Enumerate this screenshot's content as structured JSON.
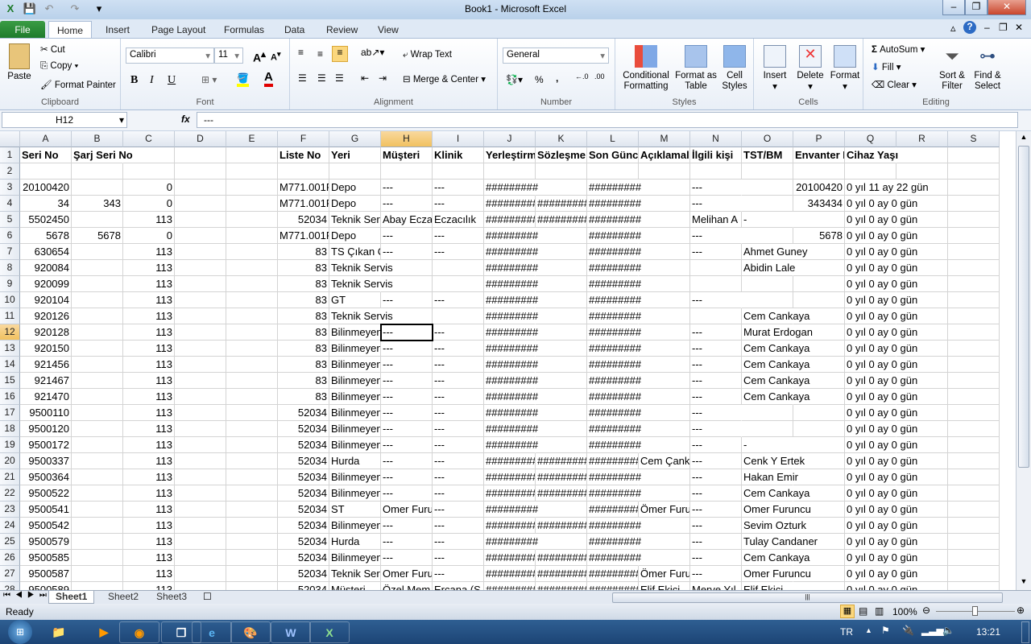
{
  "window": {
    "title": "Book1  -  Microsoft Excel",
    "minimize": "–",
    "restore": "❐",
    "close": "✕"
  },
  "quick_access": {
    "save": "💾",
    "undo": "↶",
    "redo": "↷",
    "customize": "▾"
  },
  "tabs": [
    "File",
    "Home",
    "Insert",
    "Page Layout",
    "Formulas",
    "Data",
    "Review",
    "View"
  ],
  "ribbon": {
    "clipboard": {
      "label": "Clipboard",
      "paste": "Paste",
      "cut": "Cut",
      "copy": "Copy",
      "format_painter": "Format Painter"
    },
    "font": {
      "label": "Font",
      "name": "Calibri",
      "size": "11",
      "bold": "B",
      "italic": "I",
      "underline": "U"
    },
    "alignment": {
      "label": "Alignment",
      "wrap_text": "Wrap Text",
      "merge_center": "Merge & Center"
    },
    "number": {
      "label": "Number",
      "format": "General",
      "percent": "%",
      "comma": ","
    },
    "styles": {
      "label": "Styles",
      "conditional": "Conditional Formatting",
      "format_table": "Format as Table",
      "cell_styles": "Cell Styles"
    },
    "cells": {
      "label": "Cells",
      "insert": "Insert",
      "delete": "Delete",
      "format": "Format"
    },
    "editing": {
      "label": "Editing",
      "autosum": "AutoSum",
      "fill": "Fill",
      "clear": "Clear",
      "sort_filter": "Sort & Filter",
      "find_select": "Find & Select"
    }
  },
  "formula_bar": {
    "name_box": "H12",
    "fx": "fx",
    "value": "---"
  },
  "columns": [
    "A",
    "B",
    "C",
    "D",
    "E",
    "F",
    "G",
    "H",
    "I",
    "J",
    "K",
    "L",
    "M",
    "N",
    "O",
    "P",
    "Q",
    "R",
    "S"
  ],
  "selected": {
    "col": "H",
    "row": 12
  },
  "rows": [
    [
      "Seri No",
      "Şarj Seri No",
      "",
      "",
      "",
      "Liste No",
      "Yeri",
      "Müşteri",
      "Klinik",
      "Yerleştirm",
      "Sözleşme",
      "Son Günce",
      "Açıklamal",
      "İlgili kişi",
      "TST/BM",
      "Envanter N",
      "Cihaz Yaşı"
    ],
    [],
    [
      "20100420",
      "",
      "0",
      "",
      "",
      "M771.001F",
      "Depo",
      "---",
      "---",
      "#########",
      "",
      "#########",
      "",
      "---",
      "",
      "20100420",
      "0 yıl 11 ay 22 gün"
    ],
    [
      "34",
      "343",
      "0",
      "",
      "",
      "M771.001F",
      "Depo",
      "---",
      "---",
      "#########",
      "#########",
      "#########",
      "",
      "---",
      "",
      "343434",
      "0 yıl 0 ay 0 gün"
    ],
    [
      "5502450",
      "",
      "113",
      "",
      "",
      "52034",
      "Teknik Servis",
      "Abay Eczane",
      "Eczacılık",
      "#########",
      "#########",
      "#########",
      "",
      "Melihan A",
      "-",
      "",
      "0 yıl 0 ay 0 gün"
    ],
    [
      "5678",
      "5678",
      "0",
      "",
      "",
      "M771.001F",
      "Depo",
      "---",
      "---",
      "#########",
      "",
      "#########",
      "",
      "---",
      "",
      "5678",
      "0 yıl 0 ay 0 gün"
    ],
    [
      "630654",
      "",
      "113",
      "",
      "",
      "83",
      "TS Çıkan C",
      "---",
      "---",
      "#########",
      "",
      "#########",
      "",
      "---",
      "Ahmet Guney",
      "",
      "0 yıl 0 ay 0 gün"
    ],
    [
      "920084",
      "",
      "113",
      "",
      "",
      "83",
      "Teknik Servis",
      "",
      "",
      "#########",
      "",
      "#########",
      "",
      "",
      "Abidin Lale",
      "",
      "0 yıl 0 ay 0 gün"
    ],
    [
      "920099",
      "",
      "113",
      "",
      "",
      "83",
      "Teknik Servis",
      "",
      "",
      "#########",
      "",
      "#########",
      "",
      "",
      "",
      "",
      "0 yıl 0 ay 0 gün"
    ],
    [
      "920104",
      "",
      "113",
      "",
      "",
      "83",
      "GT",
      "---",
      "---",
      "#########",
      "",
      "#########",
      "",
      "---",
      "",
      "",
      "0 yıl 0 ay 0 gün"
    ],
    [
      "920126",
      "",
      "113",
      "",
      "",
      "83",
      "Teknik Servis",
      "",
      "",
      "#########",
      "",
      "#########",
      "",
      "",
      "Cem Cankaya",
      "",
      "0 yıl 0 ay 0 gün"
    ],
    [
      "920128",
      "",
      "113",
      "",
      "",
      "83",
      "Bilinmeyen",
      "---",
      "---",
      "#########",
      "",
      "#########",
      "",
      "---",
      "Murat Erdogan",
      "",
      "0 yıl 0 ay 0 gün"
    ],
    [
      "920150",
      "",
      "113",
      "",
      "",
      "83",
      "Bilinmeyen",
      "---",
      "---",
      "#########",
      "",
      "#########",
      "",
      "---",
      "Cem Cankaya",
      "",
      "0 yıl 0 ay 0 gün"
    ],
    [
      "921456",
      "",
      "113",
      "",
      "",
      "83",
      "Bilinmeyen",
      "---",
      "---",
      "#########",
      "",
      "#########",
      "",
      "---",
      "Cem Cankaya",
      "",
      "0 yıl 0 ay 0 gün"
    ],
    [
      "921467",
      "",
      "113",
      "",
      "",
      "83",
      "Bilinmeyen",
      "---",
      "---",
      "#########",
      "",
      "#########",
      "",
      "---",
      "Cem Cankaya",
      "",
      "0 yıl 0 ay 0 gün"
    ],
    [
      "921470",
      "",
      "113",
      "",
      "",
      "83",
      "Bilinmeyen",
      "---",
      "---",
      "#########",
      "",
      "#########",
      "",
      "---",
      "Cem Cankaya",
      "",
      "0 yıl 0 ay 0 gün"
    ],
    [
      "9500110",
      "",
      "113",
      "",
      "",
      "52034",
      "Bilinmeyen",
      "---",
      "---",
      "#########",
      "",
      "#########",
      "",
      "---",
      "",
      "",
      "0 yıl 0 ay 0 gün"
    ],
    [
      "9500120",
      "",
      "113",
      "",
      "",
      "52034",
      "Bilinmeyen",
      "---",
      "---",
      "#########",
      "",
      "#########",
      "",
      "---",
      "",
      "",
      "0 yıl 0 ay 0 gün"
    ],
    [
      "9500172",
      "",
      "113",
      "",
      "",
      "52034",
      "Bilinmeyen",
      "---",
      "---",
      "#########",
      "",
      "#########",
      "",
      "---",
      "-",
      "",
      "0 yıl 0 ay 0 gün"
    ],
    [
      "9500337",
      "",
      "113",
      "",
      "",
      "52034",
      "Hurda",
      "---",
      "---",
      "#########",
      "#########",
      "#########",
      "Cem Çankaya",
      "---",
      "Cenk Y Ertek",
      "",
      "0 yıl 0 ay 0 gün"
    ],
    [
      "9500364",
      "",
      "113",
      "",
      "",
      "52034",
      "Bilinmeyen",
      "---",
      "---",
      "#########",
      "#########",
      "#########",
      "",
      "---",
      "Hakan Emir",
      "",
      "0 yıl 0 ay 0 gün"
    ],
    [
      "9500522",
      "",
      "113",
      "",
      "",
      "52034",
      "Bilinmeyen",
      "---",
      "---",
      "#########",
      "#########",
      "#########",
      "",
      "---",
      "Cem Cankaya",
      "",
      "0 yıl 0 ay 0 gün"
    ],
    [
      "9500541",
      "",
      "113",
      "",
      "",
      "52034",
      "ST",
      "Omer Furuncu",
      "---",
      "#########",
      "",
      "#########",
      "Ömer Furuncu",
      "---",
      "Omer Furuncu",
      "",
      "0 yıl 0 ay 0 gün"
    ],
    [
      "9500542",
      "",
      "113",
      "",
      "",
      "52034",
      "Bilinmeyen",
      "---",
      "---",
      "#########",
      "#########",
      "#########",
      "",
      "---",
      "Sevim Ozturk",
      "",
      "0 yıl 0 ay 0 gün"
    ],
    [
      "9500579",
      "",
      "113",
      "",
      "",
      "52034",
      "Hurda",
      "---",
      "---",
      "#########",
      "",
      "#########",
      "",
      "---",
      "Tulay Candaner",
      "",
      "0 yıl 0 ay 0 gün"
    ],
    [
      "9500585",
      "",
      "113",
      "",
      "",
      "52034",
      "Bilinmeyen",
      "---",
      "---",
      "#########",
      "#########",
      "#########",
      "",
      "---",
      "Cem Cankaya",
      "",
      "0 yıl 0 ay 0 gün"
    ],
    [
      "9500587",
      "",
      "113",
      "",
      "",
      "52034",
      "Teknik Servis",
      "Omer Furuncu",
      "---",
      "#########",
      "#########",
      "#########",
      "Ömer Furuncu",
      "---",
      "Omer Furuncu",
      "",
      "0 yıl 0 ay 0 gün"
    ],
    [
      "9500589",
      "",
      "113",
      "",
      "",
      "52034",
      "Müşteri",
      "Özel Mem",
      "Ercana (S",
      "#########",
      "#########",
      "#########",
      "Elif Ekici",
      "Merve Yıl",
      "Elif Ekici",
      "",
      "0 yıl 0 ay 0 gün"
    ]
  ],
  "sheets": [
    "Sheet1",
    "Sheet2",
    "Sheet3"
  ],
  "active_sheet": "Sheet1",
  "status": {
    "mode": "Ready",
    "zoom": "100%",
    "zoom_percent": 100
  },
  "taskbar": {
    "language": "TR",
    "time": "13:21",
    "apps": [
      "explorer",
      "media-player",
      "app",
      "windows",
      "internet-explorer",
      "paint",
      "word",
      "excel"
    ]
  }
}
